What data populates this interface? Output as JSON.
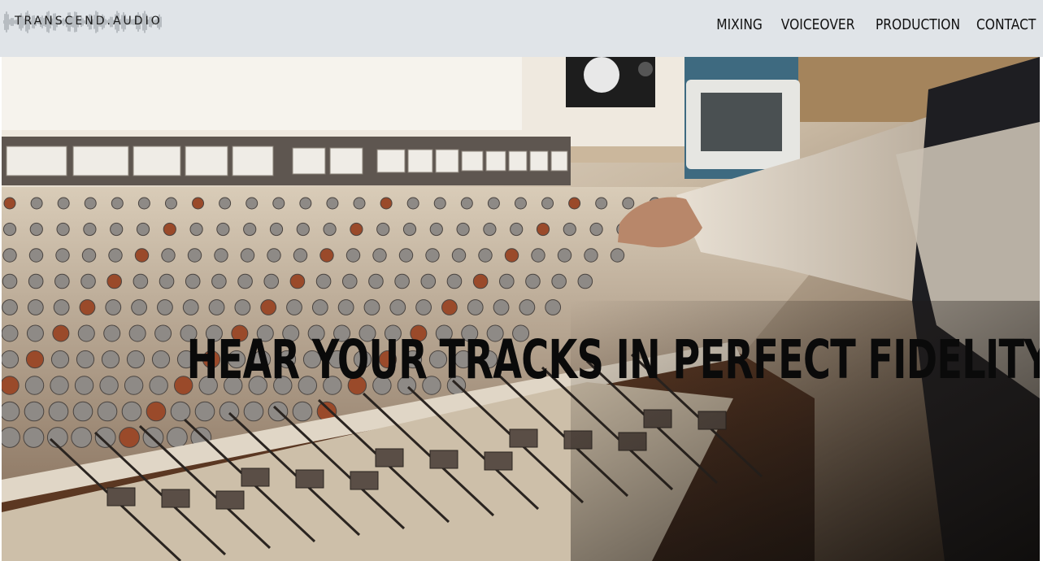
{
  "brand": {
    "logo_text": "TRANSCEND.AUDIO",
    "logo_icon": "waveform-icon"
  },
  "nav": {
    "items": [
      {
        "label": "MIXING"
      },
      {
        "label": "VOICEOVER"
      },
      {
        "label": "PRODUCTION"
      },
      {
        "label": "CONTACT"
      }
    ]
  },
  "hero": {
    "title": "HEAR YOUR TRACKS IN PERFECT FIDELITY",
    "image": "mixing-console-photo"
  },
  "colors": {
    "header_bg": "#e0e4e8",
    "text": "#0a0a0a"
  }
}
